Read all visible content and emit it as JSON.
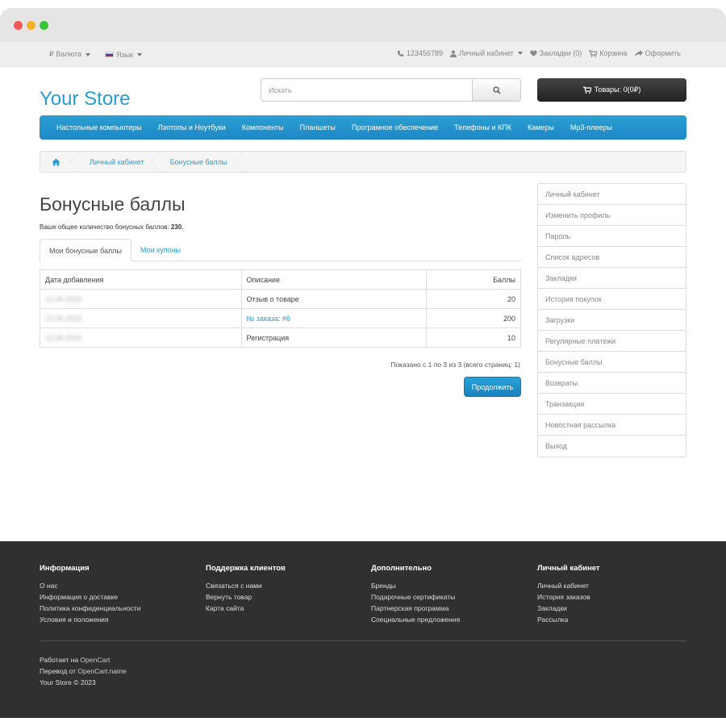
{
  "topbar": {
    "currency_label": "₽ Валюта",
    "language_label": "Язык",
    "phone": "123456789",
    "account": "Личный кабинет",
    "wishlist": "Закладки (0)",
    "cart": "Корзина",
    "checkout": "Оформить"
  },
  "header": {
    "logo": "Your Store",
    "search_placeholder": "Искать",
    "cart_button": "Товары: 0(0₽)"
  },
  "menu": [
    "Настольные компьютеры",
    "Лэптопы и Ноутбуки",
    "Компоненты",
    "Планшеты",
    "Програмное обеспечение",
    "Телефоны и КПК",
    "Камеры",
    "Mp3-плееры"
  ],
  "breadcrumb": [
    "Личный кабинет",
    "Бонусные баллы"
  ],
  "page": {
    "title": "Бонусные баллы",
    "total_prefix": "Ваше общее количество бонусных баллов: ",
    "total_value": "230",
    "total_suffix": "."
  },
  "tabs": [
    "Мои бонусные баллы",
    "Мои купоны"
  ],
  "table": {
    "headers": [
      "Дата добавления",
      "Описание",
      "Баллы"
    ],
    "rows": [
      {
        "date": "12.06.2023",
        "description": "Отзыв о товаре",
        "points": "20",
        "link": false
      },
      {
        "date": "12.06.2023",
        "description": "№ заказа: #6",
        "points": "200",
        "link": true
      },
      {
        "date": "12.06.2023",
        "description": "Регистрация",
        "points": "10",
        "link": false
      }
    ]
  },
  "pagination_text": "Показано с 1 по 3 из 3 (всего страниц: 1)",
  "continue_button": "Продолжить",
  "sidebar": [
    "Личный кабинет",
    "Изменить профиль",
    "Пароль",
    "Список адресов",
    "Закладки",
    "История покупок",
    "Загрузки",
    "Регулярные платежи",
    "Бонусные баллы",
    "Возвраты",
    "Транзакции",
    "Новостная рассылка",
    "Выход"
  ],
  "footer": {
    "columns": [
      {
        "title": "Информация",
        "links": [
          "О нас",
          "Информация о доставке",
          "Политика конфиденциальности",
          "Условия и положения"
        ]
      },
      {
        "title": "Поддержка клиентов",
        "links": [
          "Связаться с нами",
          "Вернуть товар",
          "Карта сайта"
        ]
      },
      {
        "title": "Дополнительно",
        "links": [
          "Бренды",
          "Подарочные сертификаты",
          "Партнерская программа",
          "Специальные предложения"
        ]
      },
      {
        "title": "Личный кабинет",
        "links": [
          "Личный кабинет",
          "История заказов",
          "Закладки",
          "Рассылка"
        ]
      }
    ],
    "powered_prefix": "Работает на ",
    "powered_link": "OpenCart",
    "translation_prefix": "Перевод от ",
    "translation_link": "OpenCart.name",
    "copyright": "Your Store © 2023"
  },
  "colors": {
    "accent": "#2a9cd1",
    "menu": "#229ad6",
    "footer": "#303030"
  }
}
